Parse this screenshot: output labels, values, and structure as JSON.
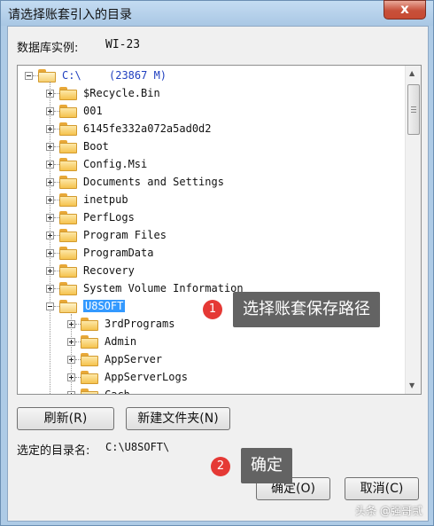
{
  "window": {
    "title": "请选择账套引入的目录",
    "close_glyph": "x"
  },
  "instance": {
    "label": "数据库实例:",
    "value": "WI-23"
  },
  "tree": {
    "root": {
      "name": "C:\\",
      "size": "(23867 M)"
    },
    "items": [
      "$Recycle.Bin",
      "001",
      "6145fe332a072a5ad0d2",
      "Boot",
      "Config.Msi",
      "Documents and Settings",
      "inetpub",
      "PerfLogs",
      "Program Files",
      "ProgramData",
      "Recovery",
      "System Volume Information"
    ],
    "selected": "U8SOFT",
    "children": [
      "3rdPrograms",
      "Admin",
      "AppServer",
      "AppServerLogs",
      "Cach"
    ]
  },
  "buttons": {
    "refresh": "刷新(R)",
    "new_folder": "新建文件夹(N)",
    "ok": "确定(O)",
    "cancel": "取消(C)"
  },
  "selected_dir": {
    "label": "选定的目录名:",
    "value": "C:\\U8SOFT\\"
  },
  "annotations": [
    {
      "num": "1",
      "text": "选择账套保存路径"
    },
    {
      "num": "2",
      "text": "确定"
    }
  ],
  "watermark": "头条 @强哥贰"
}
